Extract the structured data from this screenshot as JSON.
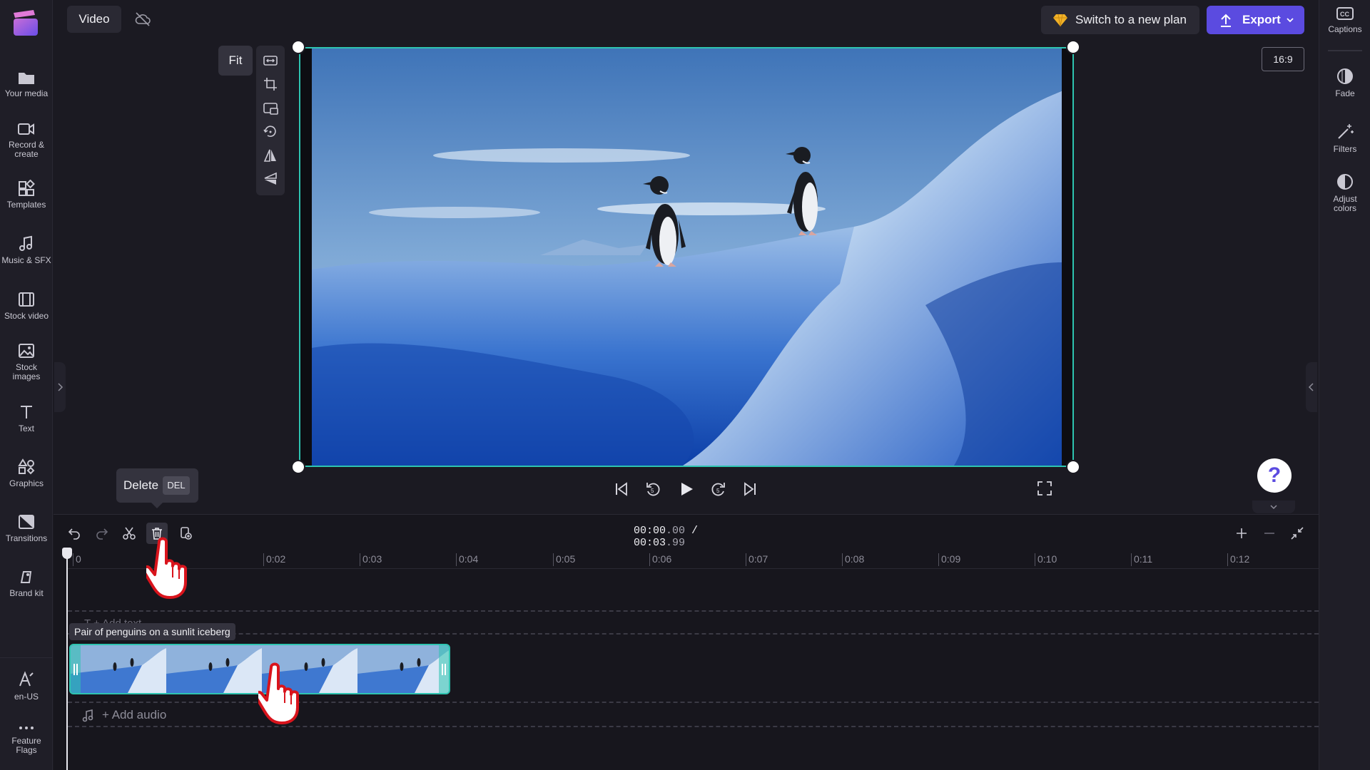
{
  "header": {
    "tab_label": "Video",
    "plan_button": "Switch to a new plan",
    "export_button": "Export",
    "aspect_ratio": "16:9"
  },
  "left_nav": [
    {
      "label": "Your media",
      "icon": "folder-icon"
    },
    {
      "label": "Record & create",
      "icon": "camera-icon"
    },
    {
      "label": "Templates",
      "icon": "templates-icon"
    },
    {
      "label": "Music & SFX",
      "icon": "music-note-icon"
    },
    {
      "label": "Stock video",
      "icon": "film-icon"
    },
    {
      "label": "Stock images",
      "icon": "image-icon"
    },
    {
      "label": "Text",
      "icon": "text-icon"
    },
    {
      "label": "Graphics",
      "icon": "shapes-icon"
    },
    {
      "label": "Transitions",
      "icon": "transitions-icon"
    },
    {
      "label": "Brand kit",
      "icon": "brand-kit-icon"
    },
    {
      "label": "en-US",
      "icon": "language-icon"
    },
    {
      "label": "Feature Flags",
      "icon": "more-dots-icon"
    }
  ],
  "right_nav": [
    {
      "label": "Captions",
      "icon": "captions-icon"
    },
    {
      "label": "Fade",
      "icon": "fade-icon"
    },
    {
      "label": "Filters",
      "icon": "magic-wand-icon"
    },
    {
      "label": "Adjust colors",
      "icon": "contrast-icon"
    }
  ],
  "preview": {
    "fit_label": "Fit",
    "tools": [
      "fill-icon",
      "crop-icon",
      "pip-icon",
      "rotate-icon",
      "flip-horizontal-icon",
      "flip-vertical-icon"
    ]
  },
  "tooltip": {
    "label": "Delete",
    "shortcut": "DEL"
  },
  "timeline": {
    "current_time": "00:00",
    "current_frac": ".00",
    "separator": " / ",
    "total_time": "00:03",
    "total_frac": ".99",
    "ticks": [
      "0",
      "0:02",
      "0:03",
      "0:04",
      "0:05",
      "0:06",
      "0:07",
      "0:08",
      "0:09",
      "0:10",
      "0:11",
      "0:12"
    ],
    "add_text": "T  + Add text",
    "clip_label": "Pair of penguins on a sunlit iceberg",
    "add_audio": "+ Add audio"
  },
  "colors": {
    "accent": "#5b4be0",
    "selection": "#2ec4b0",
    "background": "#1b1a22"
  }
}
